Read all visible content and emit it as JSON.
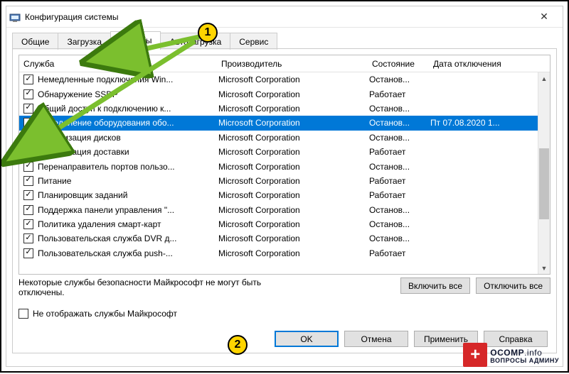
{
  "window": {
    "title": "Конфигурация системы",
    "close": "✕"
  },
  "tabs": {
    "general": "Общие",
    "boot": "Загрузка",
    "services": "Службы",
    "startup": "Автозагрузка",
    "tools": "Сервис",
    "active": "services"
  },
  "columns": {
    "service": "Служба",
    "manufacturer": "Производитель",
    "state": "Состояние",
    "date_disabled": "Дата отключения"
  },
  "services": [
    {
      "checked": true,
      "name": "Немедленные подключения Win...",
      "mfr": "Microsoft Corporation",
      "state": "Останов...",
      "date": ""
    },
    {
      "checked": true,
      "name": "Обнаружение SSDP",
      "mfr": "Microsoft Corporation",
      "state": "Работает",
      "date": ""
    },
    {
      "checked": true,
      "name": "Общий доступ к подключению к...",
      "mfr": "Microsoft Corporation",
      "state": "Останов...",
      "date": ""
    },
    {
      "checked": false,
      "name": "Определение оборудования обо...",
      "mfr": "Microsoft Corporation",
      "state": "Останов...",
      "date": "Пт 07.08.2020 1...",
      "selected": true
    },
    {
      "checked": true,
      "name": "Оптимизация дисков",
      "mfr": "Microsoft Corporation",
      "state": "Останов...",
      "date": ""
    },
    {
      "checked": true,
      "name": "Оптимизация доставки",
      "mfr": "Microsoft Corporation",
      "state": "Работает",
      "date": ""
    },
    {
      "checked": true,
      "name": "Перенаправитель портов пользо...",
      "mfr": "Microsoft Corporation",
      "state": "Останов...",
      "date": ""
    },
    {
      "checked": true,
      "name": "Питание",
      "mfr": "Microsoft Corporation",
      "state": "Работает",
      "date": ""
    },
    {
      "checked": true,
      "name": "Планировщик заданий",
      "mfr": "Microsoft Corporation",
      "state": "Работает",
      "date": ""
    },
    {
      "checked": true,
      "name": "Поддержка панели управления \"...",
      "mfr": "Microsoft Corporation",
      "state": "Останов...",
      "date": ""
    },
    {
      "checked": true,
      "name": "Политика удаления смарт-карт",
      "mfr": "Microsoft Corporation",
      "state": "Останов...",
      "date": ""
    },
    {
      "checked": true,
      "name": "Пользовательская служба DVR д...",
      "mfr": "Microsoft Corporation",
      "state": "Останов...",
      "date": ""
    },
    {
      "checked": true,
      "name": "Пользовательская служба push-...",
      "mfr": "Microsoft Corporation",
      "state": "Работает",
      "date": ""
    }
  ],
  "note_line1": "Некоторые службы безопасности Майкрософт не могут быть",
  "note_line2": "отключены.",
  "buttons": {
    "enable_all": "Включить все",
    "disable_all": "Отключить все",
    "ok": "OK",
    "cancel": "Отмена",
    "apply": "Применить",
    "help": "Справка"
  },
  "hide_ms": "Не отображать службы Майкрософт",
  "callouts": {
    "one": "1",
    "two": "2"
  },
  "watermark": {
    "main": "OCOMP",
    "suffix": ".info",
    "sub": "ВОПРОСЫ АДМИНУ",
    "badge": "+"
  }
}
